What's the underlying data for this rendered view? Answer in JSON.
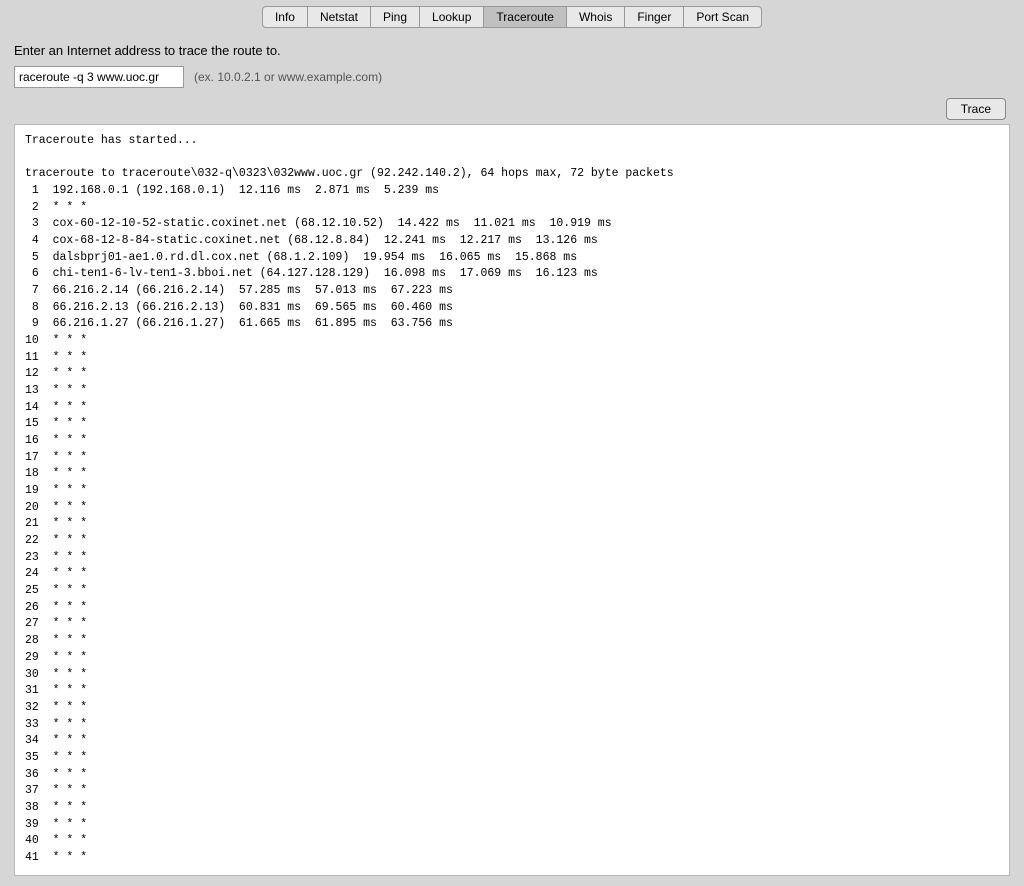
{
  "nav": {
    "tabs": [
      {
        "label": "Info",
        "active": false
      },
      {
        "label": "Netstat",
        "active": false
      },
      {
        "label": "Ping",
        "active": false
      },
      {
        "label": "Lookup",
        "active": false
      },
      {
        "label": "Traceroute",
        "active": true
      },
      {
        "label": "Whois",
        "active": false
      },
      {
        "label": "Finger",
        "active": false
      },
      {
        "label": "Port Scan",
        "active": false
      }
    ]
  },
  "description": "Enter an Internet address to trace the route to.",
  "input": {
    "value": "raceroute -q 3 www.uoc.gr",
    "placeholder": "(ex. 10.0.2.1 or www.example.com)"
  },
  "trace_button": "Trace",
  "output": "Traceroute has started...\n\ntraceroute to traceroute\\032-q\\0323\\032www.uoc.gr (92.242.140.2), 64 hops max, 72 byte packets\n 1  192.168.0.1 (192.168.0.1)  12.116 ms  2.871 ms  5.239 ms\n 2  * * *\n 3  cox-60-12-10-52-static.coxinet.net (68.12.10.52)  14.422 ms  11.021 ms  10.919 ms\n 4  cox-68-12-8-84-static.coxinet.net (68.12.8.84)  12.241 ms  12.217 ms  13.126 ms\n 5  dalsbprj01-ae1.0.rd.dl.cox.net (68.1.2.109)  19.954 ms  16.065 ms  15.868 ms\n 6  chi-ten1-6-lv-ten1-3.bboi.net (64.127.128.129)  16.098 ms  17.069 ms  16.123 ms\n 7  66.216.2.14 (66.216.2.14)  57.285 ms  57.013 ms  67.223 ms\n 8  66.216.2.13 (66.216.2.13)  60.831 ms  69.565 ms  60.460 ms\n 9  66.216.1.27 (66.216.1.27)  61.665 ms  61.895 ms  63.756 ms\n10  * * *\n11  * * *\n12  * * *\n13  * * *\n14  * * *\n15  * * *\n16  * * *\n17  * * *\n18  * * *\n19  * * *\n20  * * *\n21  * * *\n22  * * *\n23  * * *\n24  * * *\n25  * * *\n26  * * *\n27  * * *\n28  * * *\n29  * * *\n30  * * *\n31  * * *\n32  * * *\n33  * * *\n34  * * *\n35  * * *\n36  * * *\n37  * * *\n38  * * *\n39  * * *\n40  * * *\n41  * * *"
}
